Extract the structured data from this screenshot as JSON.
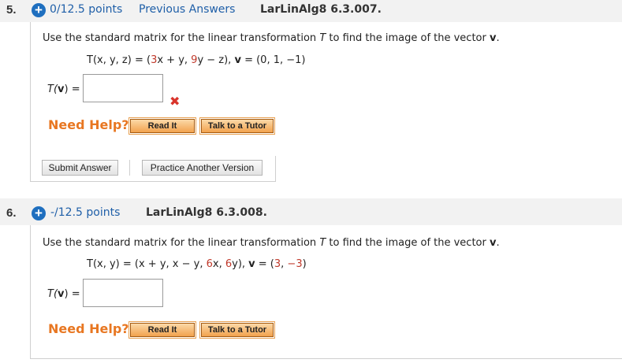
{
  "q5": {
    "number": "5.",
    "points": "0/12.5 points",
    "previous_answers": "Previous Answers",
    "code": "LarLinAlg8 6.3.007.",
    "instruction_pre": "Use the standard matrix for the linear transformation ",
    "instruction_T": "T",
    "instruction_mid": " to find the image of the vector ",
    "instruction_v": "v",
    "instruction_end": ".",
    "eq_lhs": "T(x, y, z) = (",
    "eq_c1": "3",
    "eq_p1": "x + y, ",
    "eq_c2": "9",
    "eq_p2": "y − z), ",
    "eq_vbold": "v",
    "eq_vval": " = (0, 1, −1)",
    "answer_label_T": "T(",
    "answer_label_v": "v",
    "answer_label_end": ") =",
    "answer_value": "",
    "status_icon": "incorrect-x-icon",
    "need_help": "Need Help?",
    "read_it": "Read It",
    "talk_tutor": "Talk to a Tutor",
    "submit": "Submit Answer",
    "practice": "Practice Another Version"
  },
  "q6": {
    "number": "6.",
    "points": "-/12.5 points",
    "code": "LarLinAlg8 6.3.008.",
    "instruction_pre": "Use the standard matrix for the linear transformation ",
    "instruction_T": "T",
    "instruction_mid": " to find the image of the vector ",
    "instruction_v": "v",
    "instruction_end": ".",
    "eq_lhs": "T(x, y) = (x + y, x − y, ",
    "eq_c1": "6",
    "eq_p1": "x, ",
    "eq_c2": "6",
    "eq_p2": "y), ",
    "eq_vbold": "v",
    "eq_vval_pre": " = (",
    "eq_vval_a": "3",
    "eq_vval_mid": ", ",
    "eq_vval_b": "−3",
    "eq_vval_end": ")",
    "answer_label_T": "T(",
    "answer_label_v": "v",
    "answer_label_end": ") =",
    "answer_value": "",
    "need_help": "Need Help?",
    "read_it": "Read It",
    "talk_tutor": "Talk to a Tutor"
  },
  "colors": {
    "link_blue": "#1f5fa8",
    "help_orange": "#e87722",
    "red": "#c0392b"
  }
}
